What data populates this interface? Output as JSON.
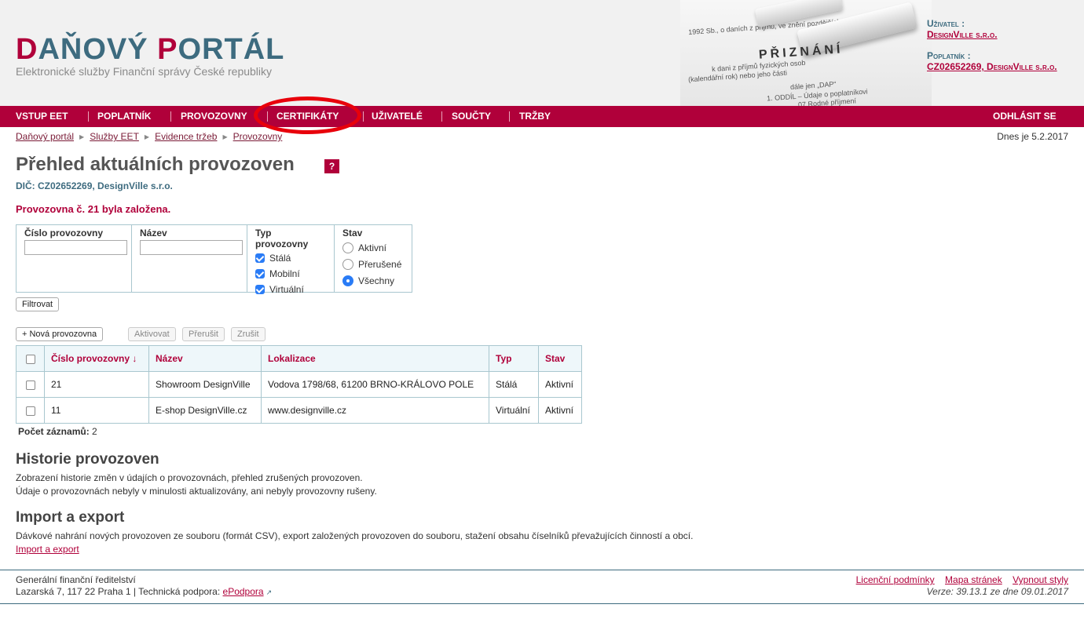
{
  "header": {
    "logo_parts": [
      "D",
      "AŇOVÝ ",
      "P",
      "ORTÁL"
    ],
    "subtitle": "Elektronické služby Finanční správy České republiky",
    "hero_title": "PŘIZNÁNÍ",
    "hero_lines": [
      "k dani z příjmů fyzických osob",
      "1992 Sb., o daních z příjmů, ve znění pozdějších předpisů",
      "(kalendářní rok)          nebo jeho části",
      "dále jen „DAP“",
      "1. ODDÍL – Údaje o poplatníkovi",
      "07 Rodné příjmení"
    ],
    "user_label": "Uživatel :",
    "user_name": "DesignVille s.r.o.",
    "payer_label": "Poplatník :",
    "payer_name": "CZ02652269, DesignVille s.r.o."
  },
  "nav": {
    "items": [
      "VSTUP EET",
      "POPLATNÍK",
      "PROVOZOVNY",
      "CERTIFIKÁTY",
      "UŽIVATELÉ",
      "SOUČTY",
      "TRŽBY"
    ],
    "logout": "ODHLÁSIT SE"
  },
  "breadcrumb": [
    "Daňový portál",
    "Služby EET",
    "Evidence tržeb",
    "Provozovny"
  ],
  "date": "Dnes je 5.2.2017",
  "page": {
    "title": "Přehled aktuálních provozoven",
    "help": "?",
    "dic": "DIČ: CZ02652269, DesignVille s.r.o.",
    "message": "Provozovna č. 21 byla založena."
  },
  "filter": {
    "number_label": "Číslo provozovny",
    "number_value": "",
    "name_label": "Název",
    "name_value": "",
    "type_label": "Typ provozovny",
    "types": [
      "Stálá",
      "Mobilní",
      "Virtuální"
    ],
    "state_label": "Stav",
    "states": [
      "Aktivní",
      "Přerušené",
      "Všechny"
    ],
    "selected_state": "Všechny",
    "submit": "Filtrovat"
  },
  "actions": {
    "new": "+ Nová provozovna",
    "activate": "Aktivovat",
    "suspend": "Přerušit",
    "cancel": "Zrušit"
  },
  "table": {
    "columns": [
      "Číslo provozovny ↓",
      "Název",
      "Lokalizace",
      "Typ",
      "Stav"
    ],
    "rows": [
      [
        "21",
        "Showroom DesignVille",
        "Vodova 1798/68, 61200 BRNO-KRÁLOVO POLE",
        "Stálá",
        "Aktivní"
      ],
      [
        "11",
        "E-shop DesignVille.cz",
        "www.designville.cz",
        "Virtuální",
        "Aktivní"
      ]
    ],
    "count_label": "Počet záznamů:",
    "count": "2"
  },
  "history": {
    "title": "Historie provozoven",
    "line1": "Zobrazení historie změn v údajích o provozovnách, přehled zrušených provozoven.",
    "line2": "Údaje o provozovnách nebyly v minulosti aktualizovány, ani nebyly provozovny rušeny."
  },
  "import": {
    "title": "Import a export",
    "text": "Dávkové nahrání nových provozoven ze souboru (formát CSV), export založených provozoven do souboru, stažení obsahu číselníků převažujících činností a obcí.",
    "link": "Import a export"
  },
  "footer": {
    "org": "Generální finanční ředitelství",
    "address": "Lazarská 7, 117 22 Praha 1 | Technická podpora:",
    "support_link": "ePodpora",
    "links": [
      "Licenční podmínky",
      "Mapa stránek",
      "Vypnout styly"
    ],
    "version": "Verze: 39.13.1 ze dne 09.01.2017"
  },
  "colors": {
    "brand": "#b0003a",
    "teal": "#3d6b7f",
    "highlight": "#e8000b"
  }
}
